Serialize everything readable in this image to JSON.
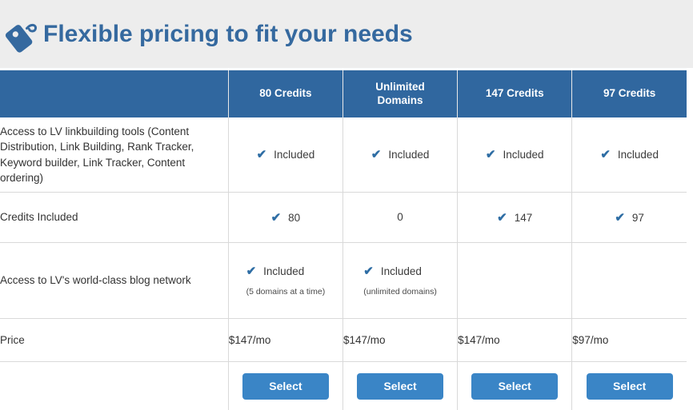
{
  "banner": {
    "icon": "price-tag-icon",
    "title": "Flexible pricing to fit your needs",
    "title_color": "#35699f",
    "background": "#ededed"
  },
  "table": {
    "header_background": "#30679f",
    "accent_color": "#2e6da4",
    "button_color": "#3a85c6",
    "columns": [
      {
        "label": ""
      },
      {
        "label": "80 Credits"
      },
      {
        "label": "Unlimited\nDomains",
        "line1": "Unlimited",
        "line2": "Domains"
      },
      {
        "label": "147 Credits"
      },
      {
        "label": "97 Credits"
      }
    ],
    "rows": [
      {
        "name": "linkbuilding-tools",
        "label": "Access to LV linkbuilding tools (Content Distribution, Link Building, Rank Tracker, Keyword builder, Link Tracker, Content ordering)",
        "cells": [
          {
            "check": true,
            "text": "Included",
            "note": ""
          },
          {
            "check": true,
            "text": "Included",
            "note": ""
          },
          {
            "check": true,
            "text": "Included",
            "note": ""
          },
          {
            "check": true,
            "text": "Included",
            "note": ""
          }
        ]
      },
      {
        "name": "credits-included",
        "label": "Credits Included",
        "cells": [
          {
            "check": true,
            "text": "80",
            "note": ""
          },
          {
            "check": false,
            "text": "0",
            "note": ""
          },
          {
            "check": true,
            "text": "147",
            "note": ""
          },
          {
            "check": true,
            "text": "97",
            "note": ""
          }
        ]
      },
      {
        "name": "blog-network",
        "label": "Access to LV's world-class blog network",
        "cells": [
          {
            "check": true,
            "text": "Included",
            "note": "(5 domains at a time)"
          },
          {
            "check": true,
            "text": "Included",
            "note": "(unlimited domains)"
          },
          {
            "check": false,
            "text": "",
            "note": ""
          },
          {
            "check": false,
            "text": "",
            "note": ""
          }
        ]
      },
      {
        "name": "price",
        "label": "Price",
        "cells": [
          {
            "check": false,
            "text": "$147/mo",
            "note": ""
          },
          {
            "check": false,
            "text": "$147/mo",
            "note": ""
          },
          {
            "check": false,
            "text": "$147/mo",
            "note": ""
          },
          {
            "check": false,
            "text": "$97/mo",
            "note": ""
          }
        ]
      }
    ],
    "buttons": [
      {
        "label": "Select"
      },
      {
        "label": "Select"
      },
      {
        "label": "Select"
      },
      {
        "label": "Select"
      }
    ],
    "check_glyph": "✔"
  }
}
